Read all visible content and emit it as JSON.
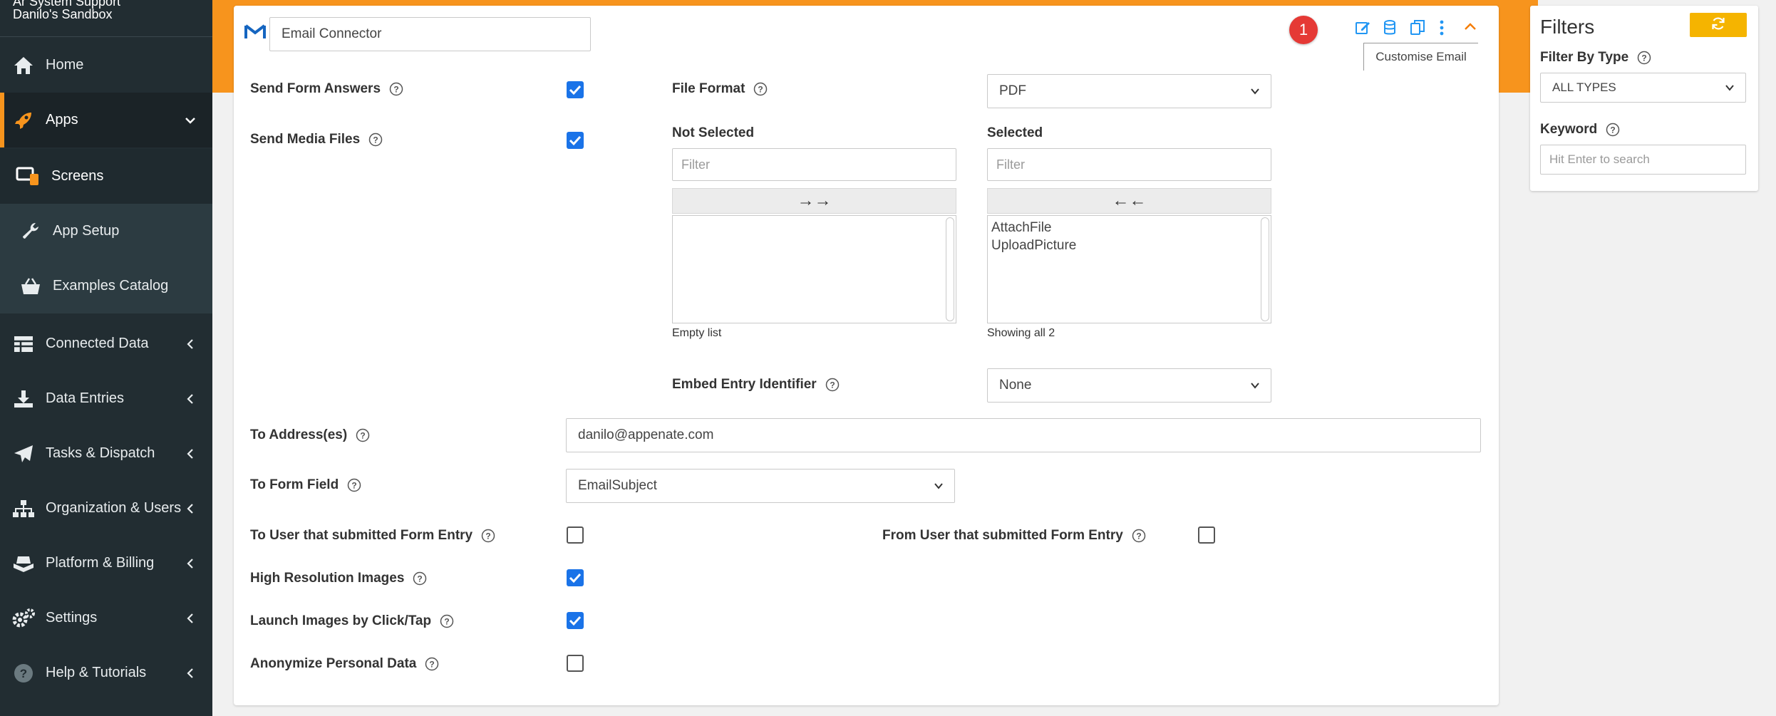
{
  "sidebar": {
    "org_title": "Ar System Support",
    "org_subtitle": "Danilo's Sandbox",
    "items": [
      {
        "label": "Home",
        "icon": "home-icon"
      },
      {
        "label": "Apps",
        "icon": "rocket-icon",
        "expanded": true
      },
      {
        "label": "Screens",
        "icon": "screens-icon"
      },
      {
        "label": "App Setup",
        "icon": "wrench-icon"
      },
      {
        "label": "Examples Catalog",
        "icon": "basket-icon"
      },
      {
        "label": "Connected Data",
        "icon": "table-icon"
      },
      {
        "label": "Data Entries",
        "icon": "download-icon"
      },
      {
        "label": "Tasks & Dispatch",
        "icon": "paper-plane-icon"
      },
      {
        "label": "Organization & Users",
        "icon": "sitemap-icon"
      },
      {
        "label": "Platform & Billing",
        "icon": "platform-icon"
      },
      {
        "label": "Settings",
        "icon": "gears-icon"
      },
      {
        "label": "Help & Tutorials",
        "icon": "question-icon"
      }
    ]
  },
  "connector": {
    "name_value": "Email Connector",
    "badge_count": "1",
    "tooltip": "Customise Email",
    "toolbar_icons": [
      "edit-icon",
      "database-icon",
      "copy-icon",
      "more-vertical-icon",
      "chevron-up-icon"
    ]
  },
  "form": {
    "send_form_answers": {
      "label": "Send Form Answers",
      "checked": true
    },
    "send_media_files": {
      "label": "Send Media Files",
      "checked": true
    },
    "file_format": {
      "label": "File Format",
      "value": "PDF"
    },
    "not_selected": {
      "title": "Not Selected",
      "filter_placeholder": "Filter",
      "move_label": "→→",
      "items": [],
      "footer": "Empty list"
    },
    "selected": {
      "title": "Selected",
      "filter_placeholder": "Filter",
      "move_label": "←←",
      "items": [
        "AttachFile",
        "UploadPicture"
      ],
      "footer": "Showing all 2"
    },
    "embed_entry_identifier": {
      "label": "Embed Entry Identifier",
      "value": "None"
    },
    "to_addresses": {
      "label": "To Address(es)",
      "value": "danilo@appenate.com"
    },
    "to_form_field": {
      "label": "To Form Field",
      "value": "EmailSubject"
    },
    "to_user_submitted": {
      "label": "To User that submitted Form Entry",
      "checked": false
    },
    "from_user_submitted": {
      "label": "From User that submitted Form Entry",
      "checked": false
    },
    "high_res_images": {
      "label": "High Resolution Images",
      "checked": true
    },
    "launch_images": {
      "label": "Launch Images by Click/Tap",
      "checked": true
    },
    "anonymize": {
      "label": "Anonymize Personal Data",
      "checked": false
    }
  },
  "filters": {
    "title": "Filters",
    "filter_by_type_label": "Filter By Type",
    "filter_by_type_value": "ALL TYPES",
    "keyword_label": "Keyword",
    "keyword_placeholder": "Hit Enter to search"
  },
  "colors": {
    "accent_orange": "#f7941d",
    "sidebar_bg": "#222d32",
    "checkbox_blue": "#1a73e8",
    "icon_blue": "#2196f3",
    "badge_red": "#e53935",
    "refresh_yellow": "#f5b400"
  }
}
